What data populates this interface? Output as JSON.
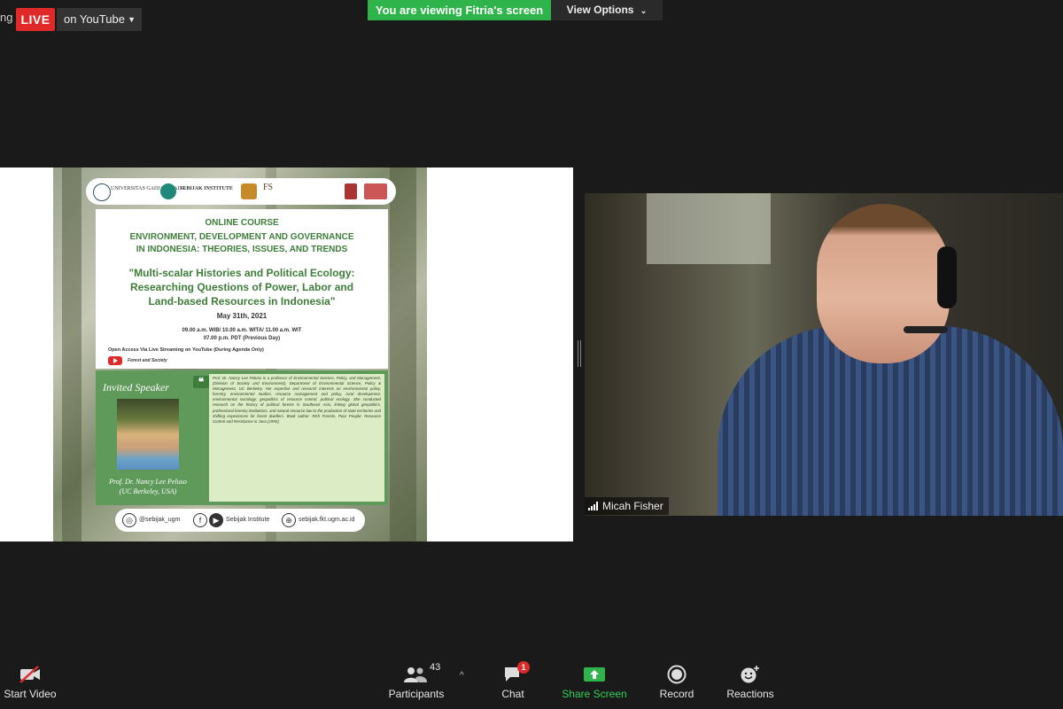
{
  "top_bar": {
    "rec_text": "ng",
    "live_badge": "LIVE",
    "live_target": "on YouTube",
    "viewing_banner": "You are viewing Fitria's screen",
    "view_options": "View Options"
  },
  "shared_screen": {
    "logos": [
      "UNIVERSITAS GADJAH MADA",
      "SEBIJAK INSTITUTE",
      "FS"
    ],
    "header": "ONLINE COURSE",
    "course_line1": "ENVIRONMENT, DEVELOPMENT AND GOVERNANCE",
    "course_line2": "IN INDONESIA: THEORIES, ISSUES, AND TRENDS",
    "title_line1": "\"Multi-scalar Histories and Political Ecology:",
    "title_line2": "Researching Questions of Power, Labor and",
    "title_line3": "Land-based Resources in Indonesia\"",
    "date": "May 31th, 2021",
    "time_line1": "09.00 a.m. WIB/ 10.00 a.m. WITA/ 11.00 a.m. WIT",
    "time_line2": "07.00 p.m. PDT (Previous Day)",
    "open_access": "Open Access Via Live Streaming on YouTube (During Agenda Only)",
    "yt_channel": "Forest and Society",
    "invited_label": "Invited Speaker",
    "speaker_name": "Prof. Dr. Nancy Lee Peluso",
    "speaker_affil": "(UC Berkeley, USA)",
    "bio": "Prof. Dr. Nancy Lee Peluso is a professor of Environmental Science, Policy, and Management, (Division of Society and Environment), Department of Environmental Science, Policy & Management, UC Berkeley. Her expertise and research interests on environmental policy, forestry, environmental studies, resource management and policy, rural development, environmental sociology, geopolitics of resource control, political ecology. She conducted research on the history of political forests in Southeast Asia, linking global geopolitics, professional forestry institutions, and natural resource law to the production of state territories and shifting experiences for forest dwellers. Book author: Rich Forests, Poor People: Resource Control and Resistance in Java (1992).",
    "social_ig": "@sebijak_ugm",
    "social_fb": "Sebijak Institute",
    "social_web": "sebijak.fkt.ugm.ac.id"
  },
  "participant": {
    "name": "Micah Fisher"
  },
  "toolbar": {
    "start_video": "Start Video",
    "participants": "Participants",
    "participants_count": "43",
    "chat": "Chat",
    "chat_badge": "1",
    "share_screen": "Share Screen",
    "record": "Record",
    "reactions": "Reactions"
  },
  "colors": {
    "live": "#e02a2a",
    "share": "#2fb44c",
    "poster_green": "#3e7d3a"
  }
}
